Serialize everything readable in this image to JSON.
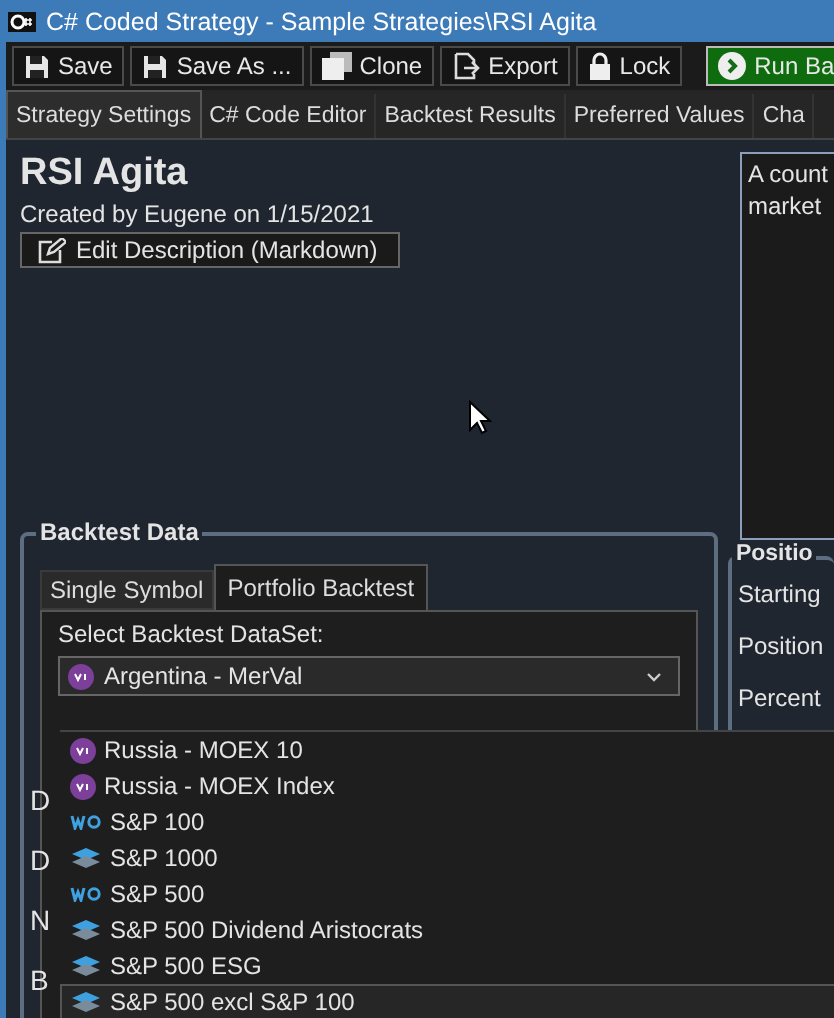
{
  "window": {
    "title": "C# Coded Strategy - Sample Strategies\\RSI Agita"
  },
  "toolbar": [
    {
      "label": "Save",
      "kind": "save"
    },
    {
      "label": "Save As ...",
      "kind": "save"
    },
    {
      "label": "Clone",
      "kind": "clone"
    },
    {
      "label": "Export",
      "kind": "export"
    },
    {
      "label": "Lock",
      "kind": "lock"
    },
    {
      "label": "Run Ba",
      "kind": "run"
    }
  ],
  "tabs": [
    {
      "label": "Strategy Settings",
      "selected": true
    },
    {
      "label": "C# Code Editor",
      "selected": false
    },
    {
      "label": "Backtest Results",
      "selected": false
    },
    {
      "label": "Preferred Values",
      "selected": false
    },
    {
      "label": "Cha",
      "selected": false
    }
  ],
  "strategy": {
    "name": "RSI Agita",
    "created": "Created by Eugene on 1/15/2021",
    "edit_button": "Edit Description (Markdown)"
  },
  "description": {
    "lines": [
      "A count",
      "market"
    ]
  },
  "backtest_data": {
    "title": "Backtest Data",
    "tabs": [
      {
        "label": "Single Symbol",
        "selected": false
      },
      {
        "label": "Portfolio Backtest",
        "selected": true
      }
    ],
    "dataset_label": "Select Backtest DataSet:",
    "dataset_value": {
      "label": "Argentina - MerVal",
      "kind": "circle"
    },
    "hidden_labels": [
      "D",
      "D",
      "N",
      "B"
    ],
    "options": [
      {
        "label": "Russia - MOEX 10",
        "kind": "circle",
        "highlighted": false
      },
      {
        "label": "Russia - MOEX Index",
        "kind": "circle",
        "highlighted": false
      },
      {
        "label": "S&P 100",
        "kind": "wo",
        "highlighted": false
      },
      {
        "label": "S&P 1000",
        "kind": "stack",
        "highlighted": false
      },
      {
        "label": "S&P 500",
        "kind": "wo",
        "highlighted": false
      },
      {
        "label": "S&P 500 Dividend Aristocrats",
        "kind": "stack",
        "highlighted": false
      },
      {
        "label": "S&P 500 ESG",
        "kind": "stack",
        "highlighted": false
      },
      {
        "label": "S&P 500 excl S&P 100",
        "kind": "stack",
        "highlighted": true
      }
    ]
  },
  "position": {
    "title": "Positio",
    "labels": [
      "Starting",
      "Position",
      "Percent"
    ]
  }
}
